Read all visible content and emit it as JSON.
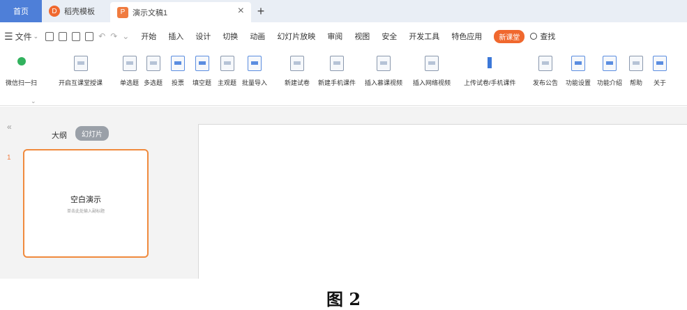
{
  "tabs": {
    "home": "首页",
    "templates": "稻壳模板",
    "document": "演示文稿1",
    "close_glyph": "×",
    "new_glyph": "+"
  },
  "menu": {
    "file_label": "文件",
    "items": [
      "开始",
      "插入",
      "设计",
      "切换",
      "动画",
      "幻灯片放映",
      "审阅",
      "视图",
      "安全",
      "开发工具",
      "特色应用"
    ],
    "badge": "新课堂",
    "search": "查找"
  },
  "ribbon": {
    "buttons": [
      "微信扫一扫",
      "开启互课堂授课",
      "单选题",
      "多选题",
      "投票",
      "填空题",
      "主观题",
      "批量导入",
      "新建试卷",
      "新建手机课件",
      "插入慕课视频",
      "插入网络视频",
      "上传试卷/手机课件",
      "发布公告",
      "功能设置",
      "功能介绍",
      "帮助",
      "关于"
    ]
  },
  "left_pane": {
    "collapse_glyph": "«",
    "outline_tab": "大纲",
    "slides_tab": "幻灯片",
    "slide_number": "1",
    "thumb_title": "空白演示",
    "thumb_subtitle": "单击此处输入副标题"
  },
  "caption": "图 2",
  "colors": {
    "home_tab": "#4e7fd8",
    "accent_orange": "#f08a3d",
    "badge": "#f0682e"
  }
}
